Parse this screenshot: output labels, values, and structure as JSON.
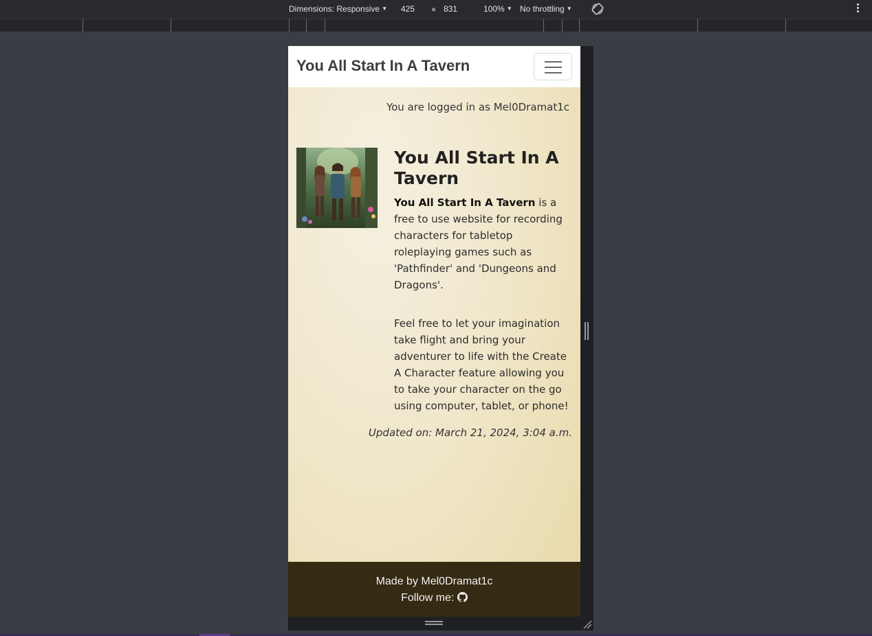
{
  "devtools": {
    "dimensions_label": "Dimensions: Responsive",
    "width": "425",
    "times": "×",
    "height": "831",
    "zoom": "100%",
    "throttling": "No throttling"
  },
  "navbar": {
    "brand": "You All Start In A Tavern"
  },
  "login_status": "You are logged in as Mel0Dramat1c",
  "main": {
    "title": "You All Start In A Tavern",
    "desc_bold": "You All Start In A Tavern",
    "desc_rest": " is a free to use website for recording characters for tabletop roleplaying games such as 'Pathfinder' and 'Dungeons and Dragons'.",
    "desc2": "Feel free to let your imagination take flight and bring your adventurer to life with the Create A Character feature allowing you to take your character on the go using computer, tablet, or phone!",
    "updated": "Updated on: March 21, 2024, 3:04 a.m."
  },
  "footer": {
    "made_by": "Made by Mel0Dramat1c",
    "follow": "Follow me:"
  },
  "colors": {
    "footer_bg": "#352a12",
    "page_bg": "#f0e7cb"
  }
}
